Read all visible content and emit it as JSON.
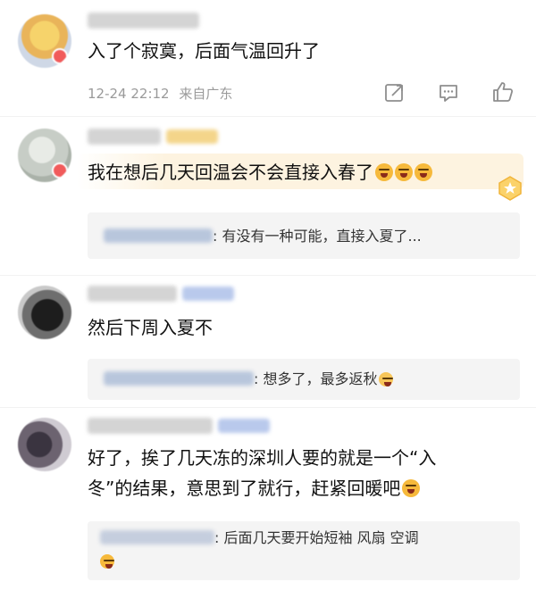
{
  "comments": [
    {
      "text": "入了个寂寞，后面气温回升了",
      "timestamp": "12-24 22:12",
      "location": "来自广东",
      "actions": {
        "share_icon": "share-icon",
        "comment_icon": "comment-icon",
        "like_icon": "thumbs-up-icon"
      }
    },
    {
      "text": "我在想后几天回温会不会直接入春了",
      "reply": {
        "text": ": 有没有一种可能，直接入夏了..."
      }
    },
    {
      "text": "然后下周入夏不",
      "reply": {
        "text": ": 想多了，最多返秋"
      }
    },
    {
      "text_line1": "好了，挨了几天冻的深圳人要的就是一个“入",
      "text_line2": "冬”的结果，意思到了就行，赶紧回暖吧",
      "reply": {
        "text": ": 后面几天要开始短袖  风扇   空调"
      }
    }
  ],
  "colors": {
    "highlight": "#fdf3e0",
    "reply_bg": "#f4f4f4",
    "meta_text": "#9a9a9a",
    "emoji": "#f6b93b"
  }
}
